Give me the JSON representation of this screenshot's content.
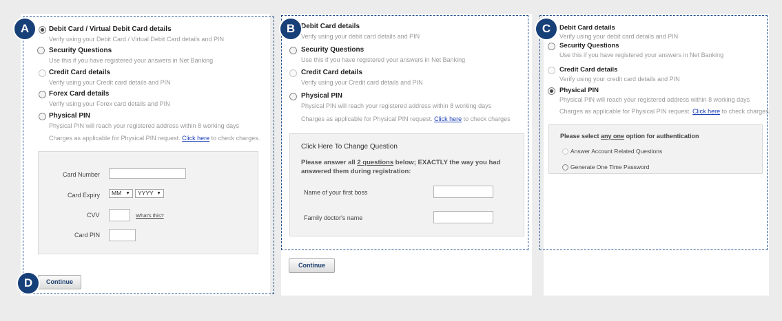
{
  "markers": {
    "a": "A",
    "b": "B",
    "c": "C",
    "d": "D"
  },
  "click_here": "Click here",
  "charges_suffix": "to check charges.",
  "charges_prefix": "Charges as applicable for Physical PIN request.",
  "panel_a": {
    "options": [
      {
        "title": "Debit Card / Virtual Debit Card details",
        "desc": "Verify using your Debit Card / Virtual Debit Card details and PIN",
        "checked": true
      },
      {
        "title": "Security Questions",
        "desc": "Use this if you have registered your answers in Net Banking",
        "checked": false
      },
      {
        "title": "Credit Card details",
        "desc": "Verify using your Credit card details and PIN",
        "checked": false
      },
      {
        "title": "Forex Card details",
        "desc": "Verify using your Forex card details and PIN",
        "checked": false
      },
      {
        "title": "Physical PIN",
        "desc": "Physical PIN will reach your registered address within 8 working days",
        "checked": false
      }
    ],
    "form": {
      "card_number": "Card Number",
      "card_expiry": "Card Expiry",
      "month": "MM",
      "year": "YYYY",
      "cvv": "CVV",
      "whats_this": "What's this?",
      "card_pin": "Card PIN"
    },
    "continue": "Continue"
  },
  "panel_b": {
    "options": [
      {
        "title": "Debit Card details",
        "desc": "Verify using your debit card details and PIN",
        "checked": false
      },
      {
        "title": "Security Questions",
        "desc": "Use this if you have registered your answers in Net Banking",
        "checked": false
      },
      {
        "title": "Credit Card details",
        "desc": "Verify using your Credit card details and PIN",
        "checked": false
      },
      {
        "title": "Physical PIN",
        "desc": "Physical PIN will reach your registered address within 8 working days",
        "checked": false
      }
    ],
    "charges_suffix": "to check charges",
    "change_question": "Click Here To Change Question",
    "instr_prefix": "Please answer all ",
    "instr_emph": "2 questions",
    "instr_suffix": " below; EXACTLY the way you had",
    "instr_line2": "answered them during registration:",
    "q1": "Name of your first boss",
    "q2": "Family doctor's name",
    "continue": "Continue"
  },
  "panel_c": {
    "options": [
      {
        "title": "Debit Card details",
        "desc": "Verify using your debit card details and PIN",
        "checked": false
      },
      {
        "title": "Security Questions",
        "desc": "Use this if you have registered your answers in Net Banking",
        "checked": false
      },
      {
        "title": "Credit Card details",
        "desc": "Verify using your credit card details and PIN",
        "checked": false
      },
      {
        "title": "Physical PIN",
        "desc": "Physical PIN will reach your registered address within 8 working days",
        "checked": true
      }
    ],
    "auth_prefix": "Please select ",
    "auth_emph": "any one",
    "auth_suffix": " option for authentication",
    "auth_options": [
      "Answer Account Related Questions",
      "Generate One Time Password"
    ]
  }
}
